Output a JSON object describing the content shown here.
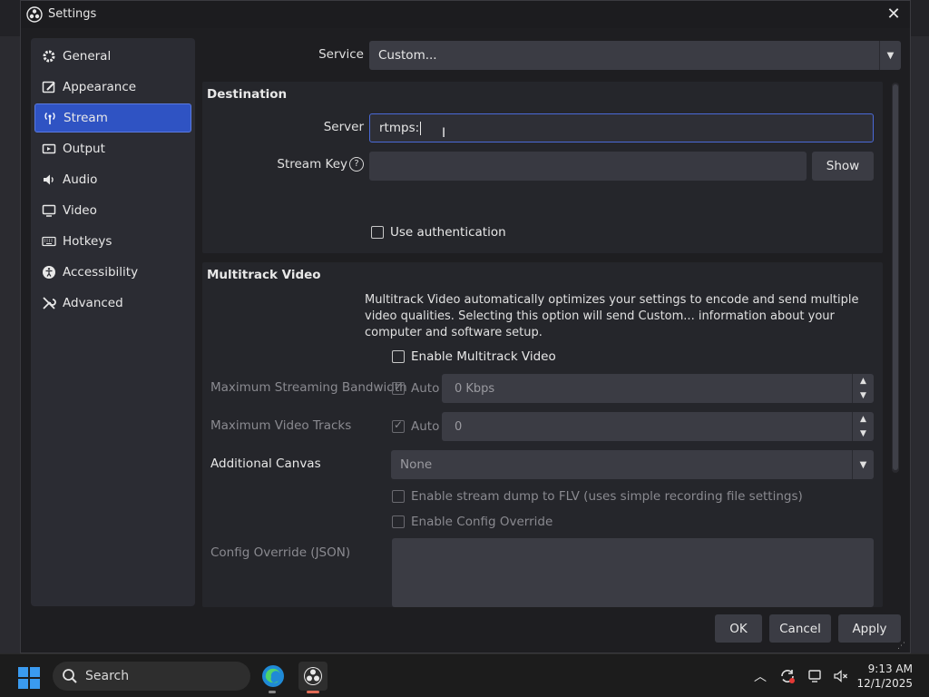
{
  "window": {
    "title": "Settings"
  },
  "sidebar": {
    "items": [
      {
        "label": "General",
        "icon": "gear-icon"
      },
      {
        "label": "Appearance",
        "icon": "appearance-icon"
      },
      {
        "label": "Stream",
        "icon": "antenna-icon",
        "active": true
      },
      {
        "label": "Output",
        "icon": "output-icon"
      },
      {
        "label": "Audio",
        "icon": "speaker-icon"
      },
      {
        "label": "Video",
        "icon": "monitor-icon"
      },
      {
        "label": "Hotkeys",
        "icon": "keyboard-icon"
      },
      {
        "label": "Accessibility",
        "icon": "accessibility-icon"
      },
      {
        "label": "Advanced",
        "icon": "wrench-icon"
      }
    ]
  },
  "stream": {
    "service_label": "Service",
    "service_value": "Custom...",
    "destination": {
      "title": "Destination",
      "server_label": "Server",
      "server_value": "rtmps:",
      "stream_key_label": "Stream Key",
      "stream_key_value": "",
      "show_button": "Show",
      "use_auth_label": "Use authentication"
    },
    "multitrack": {
      "title": "Multitrack Video",
      "description": "Multitrack Video automatically optimizes your settings to encode and send multiple video qualities. Selecting this option will send Custom... information about your computer and software setup.",
      "enable_label": "Enable Multitrack Video",
      "max_bandwidth_label": "Maximum Streaming Bandwidth",
      "max_bandwidth_auto": "Auto",
      "max_bandwidth_value": "0 Kbps",
      "max_tracks_label": "Maximum Video Tracks",
      "max_tracks_auto": "Auto",
      "max_tracks_value": "0",
      "additional_canvas_label": "Additional Canvas",
      "additional_canvas_value": "None",
      "dump_flv_label": "Enable stream dump to FLV (uses simple recording file settings)",
      "config_override_label": "Enable Config Override",
      "config_json_label": "Config Override (JSON)"
    }
  },
  "footer": {
    "ok": "OK",
    "cancel": "Cancel",
    "apply": "Apply"
  },
  "taskbar": {
    "search_placeholder": "Search",
    "time": "9:13 AM",
    "date": "12/1/2025"
  },
  "colors": {
    "accent": "#2f53c3",
    "windows_blue": "#3a9bf0"
  }
}
